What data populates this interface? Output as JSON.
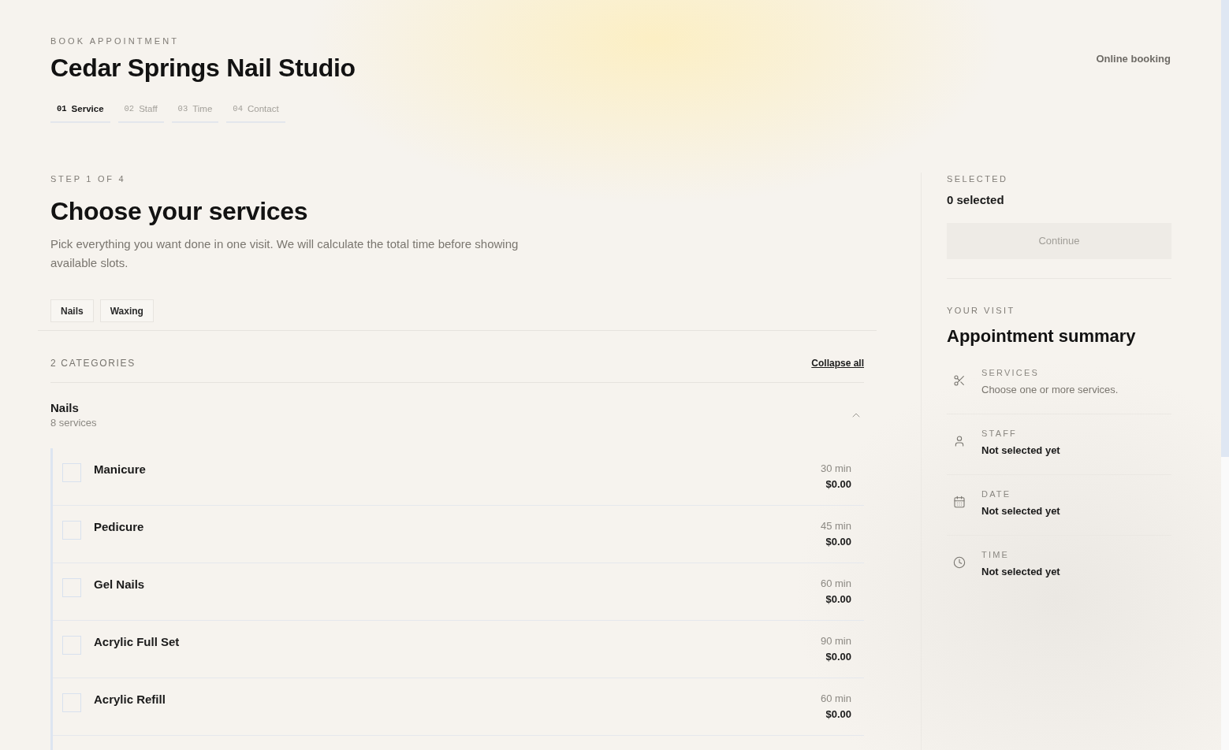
{
  "header": {
    "eyebrow": "BOOK APPOINTMENT",
    "title": "Cedar Springs Nail Studio",
    "mode": "Online booking"
  },
  "steps": [
    {
      "number": "01",
      "label": "Service",
      "selected": true
    },
    {
      "number": "02",
      "label": "Staff",
      "selected": false
    },
    {
      "number": "03",
      "label": "Time",
      "selected": false
    },
    {
      "number": "04",
      "label": "Contact",
      "selected": false
    }
  ],
  "intro": {
    "step": "STEP 1 OF 4",
    "title": "Choose your services",
    "description": "Pick everything you want done in one visit. We will calculate the total time before showing available slots."
  },
  "category_chips": [
    "Nails",
    "Waxing"
  ],
  "categories_bar": {
    "count": "2 CATEGORIES",
    "action": "Collapse all"
  },
  "categories": [
    {
      "name": "Nails",
      "count": "8 services",
      "expanded": true,
      "services": [
        {
          "name": "Manicure",
          "duration": "30 min",
          "price": "$0.00",
          "checked": false
        },
        {
          "name": "Pedicure",
          "duration": "45 min",
          "price": "$0.00",
          "checked": false
        },
        {
          "name": "Gel Nails",
          "duration": "60 min",
          "price": "$0.00",
          "checked": false
        },
        {
          "name": "Acrylic Full Set",
          "duration": "90 min",
          "price": "$0.00",
          "checked": false
        },
        {
          "name": "Acrylic Refill",
          "duration": "60 min",
          "price": "$0.00",
          "checked": false
        }
      ]
    }
  ],
  "sidebar": {
    "selected_label": "SELECTED",
    "selected_count": "0 selected",
    "continue_button": {
      "label": "Continue",
      "disabled": true
    },
    "eyebrow": "YOUR VISIT",
    "title": "Appointment summary",
    "items": [
      {
        "label": "SERVICES",
        "value": "Choose one or more services.",
        "kind": "hint"
      },
      {
        "label": "STAFF",
        "value": "Not selected yet",
        "kind": "value"
      },
      {
        "label": "DATE",
        "value": "Not selected yet",
        "kind": "value"
      },
      {
        "label": "TIME",
        "value": "Not selected yet",
        "kind": "value"
      }
    ]
  }
}
